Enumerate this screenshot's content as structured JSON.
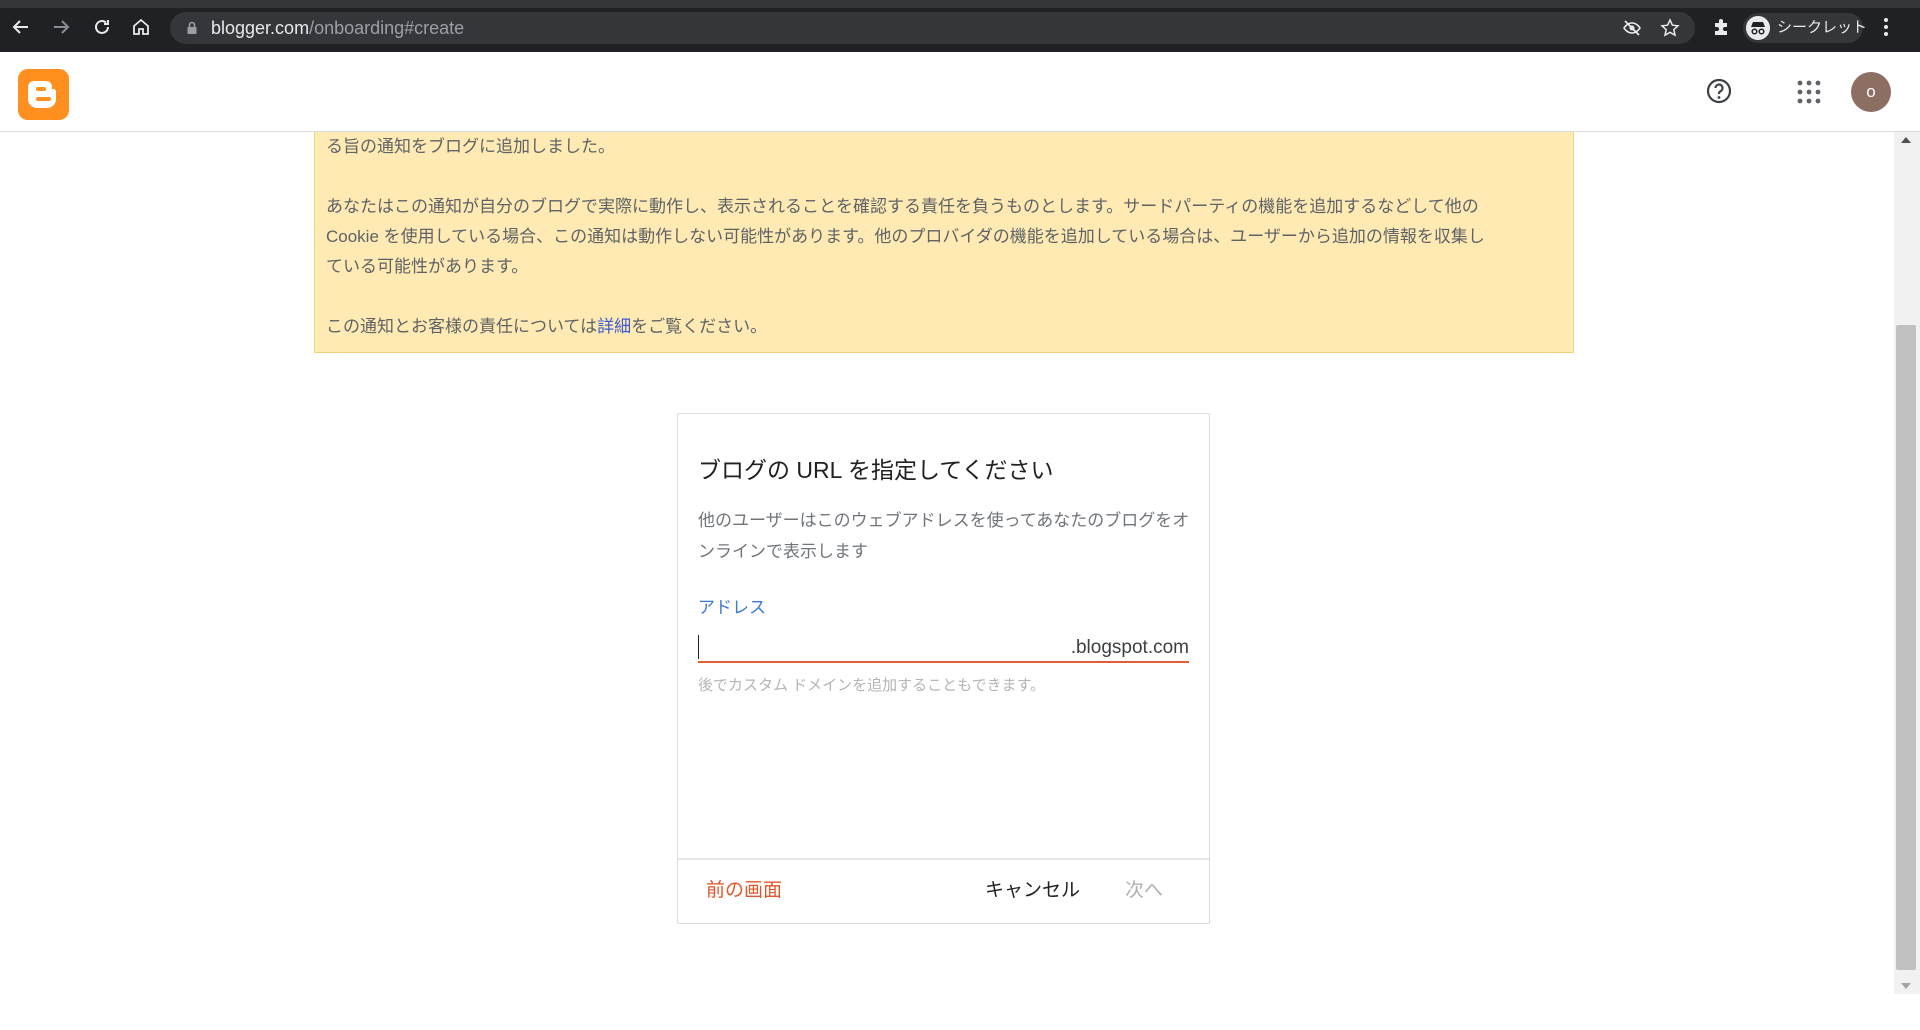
{
  "browser": {
    "url_host": "blogger.com",
    "url_path": "/onboarding#create",
    "incognito_label": "シークレット"
  },
  "header": {
    "avatar_initial": "o"
  },
  "notice": {
    "line1": "る旨の通知をブログに追加しました。",
    "para2_line1": "あなたはこの通知が自分のブログで実際に動作し、表示されることを確認する責任を負うものとします。サードパーティの機能を追加するなどして他の",
    "para2_line2": "Cookie を使用している場合、この通知は動作しない可能性があります。他のプロバイダの機能を追加している場合は、ユーザーから追加の情報を収集し",
    "para2_line3": "ている可能性があります。",
    "para3_prefix": "この通知とお客様の責任については",
    "para3_link": "詳細",
    "para3_suffix": "をご覧ください。"
  },
  "dialog": {
    "title": "ブログの URL を指定してください",
    "description": "他のユーザーはこのウェブアドレスを使ってあなたのブログをオンラインで表示します",
    "address_label": "アドレス",
    "address_value": "",
    "address_suffix": ".blogspot.com",
    "hint": "後でカスタム ドメインを追加することもできます。",
    "back_label": "前の画面",
    "cancel_label": "キャンセル",
    "next_label": "次へ"
  },
  "colors": {
    "accent_orange": "#e2562a",
    "link_blue": "#3b7bd6",
    "notice_bg": "#feeab2",
    "blogger_orange": "#ff8f1f"
  }
}
